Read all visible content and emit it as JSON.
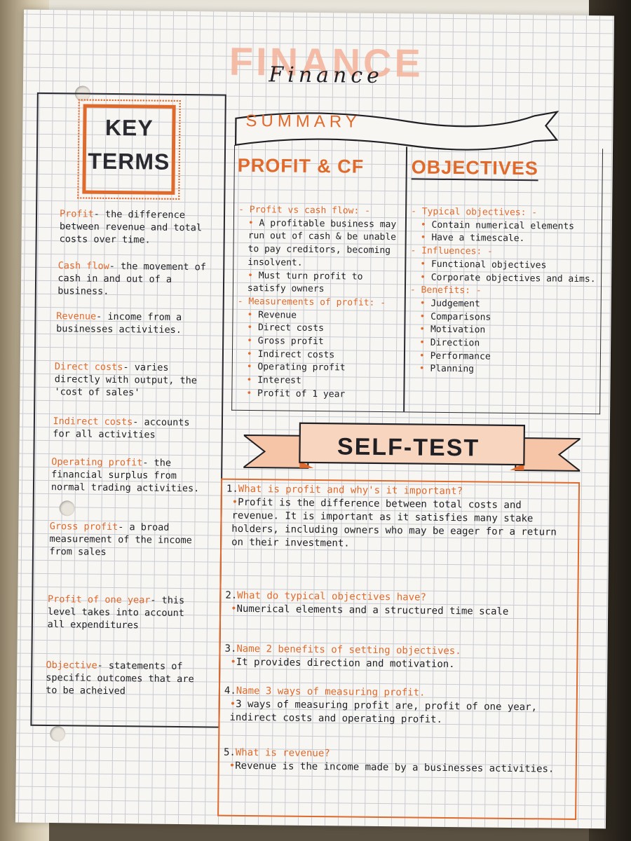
{
  "title": {
    "outline": "FINANCE",
    "script": "Finance"
  },
  "key_terms": {
    "heading_line1": "KEY",
    "heading_line2": "TERMS",
    "items": [
      {
        "term": "Profit",
        "def": "- the difference between revenue and total costs over time."
      },
      {
        "term": "Cash flow",
        "def": "- the movement of cash in and out of a business."
      },
      {
        "term": "Revenue",
        "def": "- income from a businesses activities."
      },
      {
        "term": "Direct costs",
        "def": "- varies directly with output, the 'cost of sales'"
      },
      {
        "term": "Indirect costs",
        "def": "- accounts for all activities"
      },
      {
        "term": "Operating profit",
        "def": "- the financial surplus from normal trading activities."
      },
      {
        "term": "Gross profit",
        "def": "- a broad measurement of the income from sales"
      },
      {
        "term": "Profit of one year",
        "def": "- this level takes into account all expenditures"
      },
      {
        "term": "Objective",
        "def": "- statements of specific outcomes that are to be acheived"
      }
    ]
  },
  "summary": {
    "banner": "SUMMARY",
    "col1": {
      "heading": "PROFIT & CF",
      "sub1": "Profit vs cash flow:",
      "sub1_items": [
        "A profitable business may run out of cash & be unable to pay creditors, becoming insolvent.",
        "Must turn profit to satisfy owners"
      ],
      "sub2": "Measurements of profit:",
      "sub2_items": [
        "Revenue",
        "Direct costs",
        "Gross profit",
        "Indirect costs",
        "Operating profit",
        "Interest",
        "Profit of 1 year"
      ]
    },
    "col2": {
      "heading": "OBJECTIVES",
      "sub1": "Typical objectives:",
      "sub1_items": [
        "Contain numerical elements",
        "Have a timescale."
      ],
      "sub2": "Influences:",
      "sub2_items": [
        "Functional objectives",
        "Corporate objectives and aims."
      ],
      "sub3": "Benefits:",
      "sub3_items": [
        "Judgement",
        "Comparisons",
        "Motivation",
        "Direction",
        "Performance",
        "Planning"
      ]
    }
  },
  "self_test": {
    "banner": "SELF-TEST",
    "questions": [
      {
        "num": "1.",
        "q": "What is profit and why's it important?",
        "a": "Profit is the difference between total costs and revenue. It is important as it satisfies many stake holders, including owners who may be eager for a return on their investment."
      },
      {
        "num": "2.",
        "q": "What do typical objectives have?",
        "a": "Numerical elements and a structured time scale"
      },
      {
        "num": "3.",
        "q": "Name 2 benefits of setting objectives.",
        "a": "It provides direction and motivation."
      },
      {
        "num": "4.",
        "q": "Name 3 ways of measuring profit.",
        "a": "3 ways of measuring profit are, profit of one year, indirect costs and operating profit."
      },
      {
        "num": "5.",
        "q": "What is revenue?",
        "a": "Revenue is the income made by a businesses activities."
      }
    ]
  },
  "colors": {
    "accent": "#e06a2c",
    "ink": "#1f1f24",
    "grid": "#c9ccd2"
  }
}
